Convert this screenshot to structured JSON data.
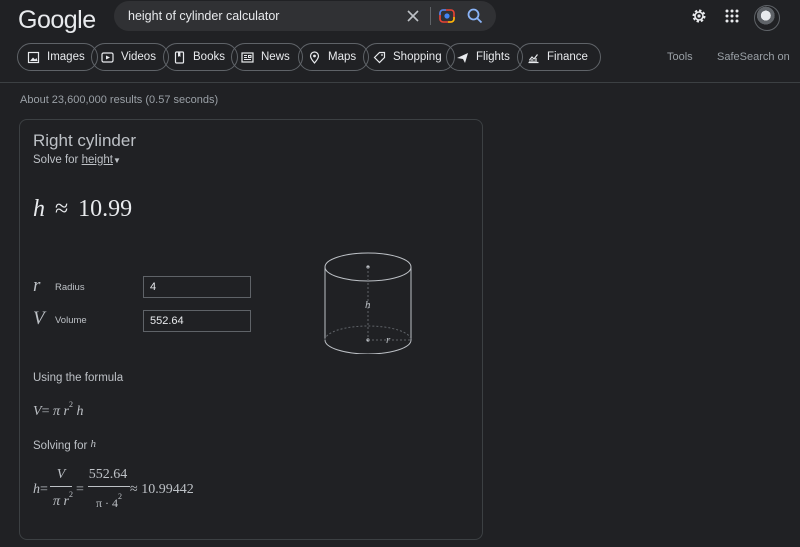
{
  "logo": "Google",
  "search": {
    "query": "height of cylinder calculator"
  },
  "tabs": [
    "Images",
    "Videos",
    "Books",
    "News",
    "Maps",
    "Shopping",
    "Flights",
    "Finance"
  ],
  "header_right": {
    "tools": "Tools",
    "safesearch": "SafeSearch on"
  },
  "stats": "About 23,600,000 results (0.57 seconds)",
  "calculator": {
    "title": "Right cylinder",
    "solve_prefix": "Solve for",
    "solve_target": "height",
    "result_var": "h",
    "result_symbol": "≈",
    "result_value": "10.99",
    "radius": {
      "symbol": "r",
      "label": "Radius",
      "value": "4"
    },
    "volume": {
      "symbol": "V",
      "label": "Volume",
      "value": "552.64"
    },
    "using_formula_label": "Using the formula",
    "formula": {
      "lhs": "V",
      "eq": "=",
      "pi": "π",
      "r": "r",
      "exp": "2",
      "h": "h"
    },
    "solving_for_label": "Solving for",
    "solving_for_var": "h",
    "solution": {
      "lhs": "h",
      "eq": "=",
      "num1": "V",
      "den1_pi": "π",
      "den1_r": "r",
      "den1_exp": "2",
      "num2": "552.64",
      "den2": "π · 4",
      "den2_exp": "2",
      "approx": "≈",
      "value": "10.99442"
    },
    "diagram": {
      "h_label": "h",
      "r_label": "r"
    }
  },
  "colors": {
    "background": "#202124",
    "search_bg": "#303134",
    "border": "#5f6368",
    "text": "#bdc1c6"
  }
}
